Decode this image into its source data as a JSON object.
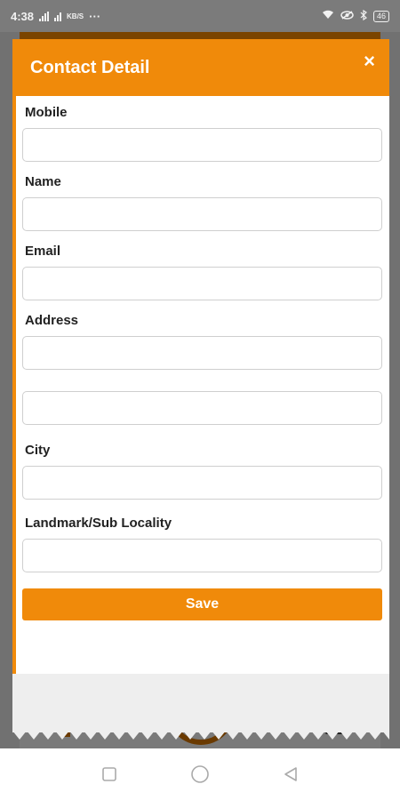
{
  "status_bar": {
    "time": "4:38",
    "dots": "···",
    "speed_label": "KB/S",
    "battery": "46"
  },
  "modal": {
    "title": "Contact Detail",
    "close_icon": "×",
    "fields": {
      "mobile": {
        "label": "Mobile",
        "value": "",
        "placeholder": ""
      },
      "name": {
        "label": "Name",
        "value": "",
        "placeholder": ""
      },
      "email": {
        "label": "Email",
        "value": "",
        "placeholder": ""
      },
      "address": {
        "label": "Address",
        "value": "",
        "placeholder": ""
      },
      "address2": {
        "value": "",
        "placeholder": ""
      },
      "city": {
        "label": "City",
        "value": "",
        "placeholder": ""
      },
      "landmark": {
        "label": "Landmark/Sub Locality",
        "value": "",
        "placeholder": ""
      }
    },
    "save_label": "Save"
  },
  "colors": {
    "accent": "#f08a0a",
    "scrim": "#7a7a7a"
  }
}
